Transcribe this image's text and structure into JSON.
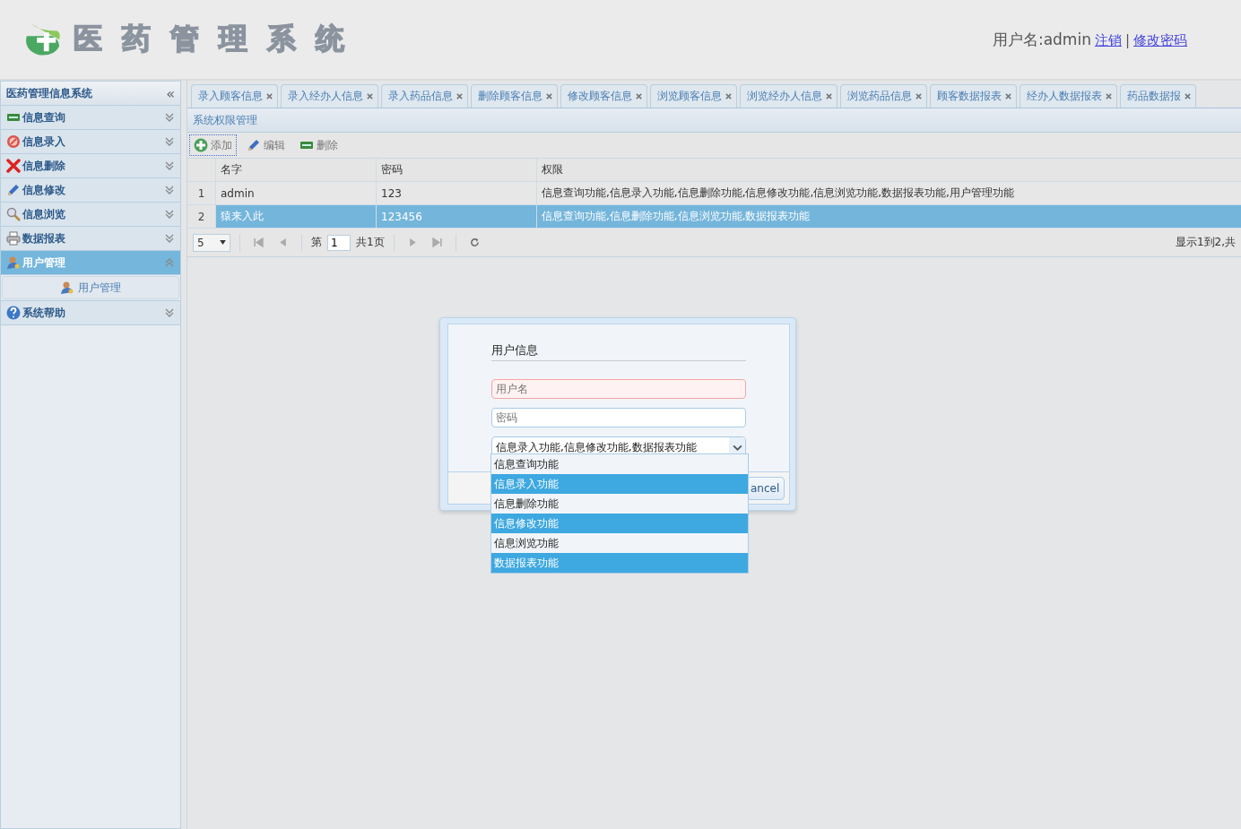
{
  "header": {
    "logo_text": "医药管理系统",
    "user_label": "用户名:admin",
    "logout_link": "注销",
    "separator": "|",
    "change_password_link": "修改密码"
  },
  "sidebar": {
    "title": "医药管理信息系统",
    "collapse_icon": "«",
    "items": [
      {
        "label": "信息查询",
        "expanded": false
      },
      {
        "label": "信息录入",
        "expanded": false
      },
      {
        "label": "信息删除",
        "expanded": false
      },
      {
        "label": "信息修改",
        "expanded": false
      },
      {
        "label": "信息浏览",
        "expanded": false
      },
      {
        "label": "数据报表",
        "expanded": false
      },
      {
        "label": "用户管理",
        "expanded": true,
        "children": [
          {
            "label": "用户管理"
          }
        ]
      },
      {
        "label": "系统帮助",
        "expanded": false
      }
    ]
  },
  "tabs": [
    {
      "label": "录入顾客信息"
    },
    {
      "label": "录入经办人信息"
    },
    {
      "label": "录入药品信息"
    },
    {
      "label": "删除顾客信息"
    },
    {
      "label": "修改顾客信息"
    },
    {
      "label": "浏览顾客信息"
    },
    {
      "label": "浏览经办人信息"
    },
    {
      "label": "浏览药品信息"
    },
    {
      "label": "顾客数据报表"
    },
    {
      "label": "经办人数据报表"
    },
    {
      "label": "药品数据报"
    }
  ],
  "panel": {
    "title": "系统权限管理",
    "toolbar": [
      {
        "label": "添加",
        "focused": true
      },
      {
        "label": "编辑",
        "focused": false
      },
      {
        "label": "删除",
        "focused": false
      }
    ],
    "table": {
      "columns": [
        "名字",
        "密码",
        "权限"
      ],
      "rows": [
        {
          "index": "1",
          "cells": [
            "admin",
            "123",
            "信息查询功能,信息录入功能,信息删除功能,信息修改功能,信息浏览功能,数据报表功能,用户管理功能"
          ],
          "selected": false
        },
        {
          "index": "2",
          "cells": [
            "猿来入此",
            "123456",
            "信息查询功能,信息删除功能,信息浏览功能,数据报表功能"
          ],
          "selected": true
        }
      ]
    },
    "pager": {
      "page_size": "5",
      "page_prefix": "第",
      "page": "1",
      "page_total": "共1页",
      "summary": "显示1到2,共"
    }
  },
  "dialog": {
    "title": "用户信息",
    "username": {
      "placeholder": "用户名",
      "invalid": true
    },
    "password": {
      "placeholder": "密码",
      "invalid": false
    },
    "permissions_value": "信息录入功能,信息修改功能,数据报表功能",
    "options": [
      {
        "label": "信息查询功能",
        "selected": false
      },
      {
        "label": "信息录入功能",
        "selected": true
      },
      {
        "label": "信息删除功能",
        "selected": false
      },
      {
        "label": "信息修改功能",
        "selected": true
      },
      {
        "label": "信息浏览功能",
        "selected": false
      },
      {
        "label": "数据报表功能",
        "selected": true
      }
    ],
    "cancel_button": "ancel"
  }
}
